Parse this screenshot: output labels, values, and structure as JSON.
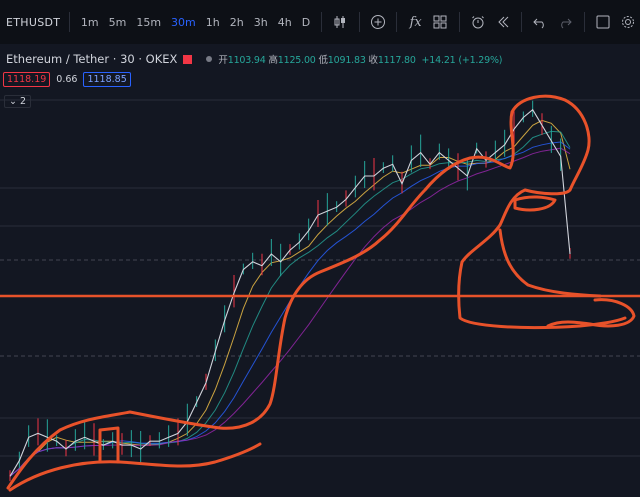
{
  "toolbar": {
    "symbol": "ETHUSDT",
    "timeframes": [
      "1m",
      "5m",
      "15m",
      "30m",
      "1h",
      "2h",
      "3h",
      "4h",
      "D"
    ],
    "active_timeframe": "30m",
    "icons": [
      "plus-circle-icon",
      "indicators-fx-icon",
      "templates-icon",
      "alert-icon",
      "replay-icon",
      "undo-icon",
      "redo-icon",
      "layout-icon",
      "settings-icon"
    ],
    "fx_label": "fx"
  },
  "legend": {
    "title": "Ethereum / Tether · 30 · OKEX",
    "open_label": "开",
    "open": "1103.94",
    "high_label": "高",
    "high": "1125.00",
    "low_label": "低",
    "low": "1091.83",
    "close_label": "收",
    "close": "1117.80",
    "change": "+14.21 (+1.29%)"
  },
  "prices": {
    "bid": "1118.19",
    "spread": "0.66",
    "ask": "1118.85"
  },
  "indicator_toggle": "2",
  "colors": {
    "background": "#131722",
    "toolbar": "#0d1016",
    "accent": "#2962ff",
    "up": "#26a69a",
    "down": "#f23645",
    "annotation": "#e8522a"
  },
  "chart_data": {
    "type": "line",
    "x": [
      0,
      1,
      2,
      3,
      4,
      5,
      6,
      7,
      8,
      9,
      10,
      11,
      12,
      13,
      14,
      15,
      16,
      17,
      18,
      19,
      20,
      21,
      22,
      23,
      24,
      25,
      26,
      27,
      28,
      29,
      30,
      31,
      32,
      33,
      34,
      35,
      36,
      37,
      38,
      39,
      40,
      41,
      42,
      43,
      44,
      45,
      46,
      47,
      48,
      49,
      50,
      51,
      52,
      53,
      54,
      55,
      56,
      57,
      58,
      59,
      60
    ],
    "series": [
      {
        "values": [
          0.03,
          0.07,
          0.13,
          0.14,
          0.13,
          0.12,
          0.1,
          0.12,
          0.13,
          0.12,
          0.11,
          0.12,
          0.11,
          0.11,
          0.1,
          0.12,
          0.12,
          0.13,
          0.14,
          0.17,
          0.22,
          0.27,
          0.35,
          0.43,
          0.5,
          0.56,
          0.58,
          0.57,
          0.6,
          0.58,
          0.61,
          0.63,
          0.66,
          0.7,
          0.71,
          0.72,
          0.74,
          0.77,
          0.8,
          0.8,
          0.82,
          0.83,
          0.78,
          0.84,
          0.86,
          0.83,
          0.86,
          0.84,
          0.82,
          0.8,
          0.87,
          0.84,
          0.86,
          0.88,
          0.92,
          0.95,
          0.97,
          0.93,
          0.89,
          0.85,
          0.6
        ]
      }
    ]
  }
}
